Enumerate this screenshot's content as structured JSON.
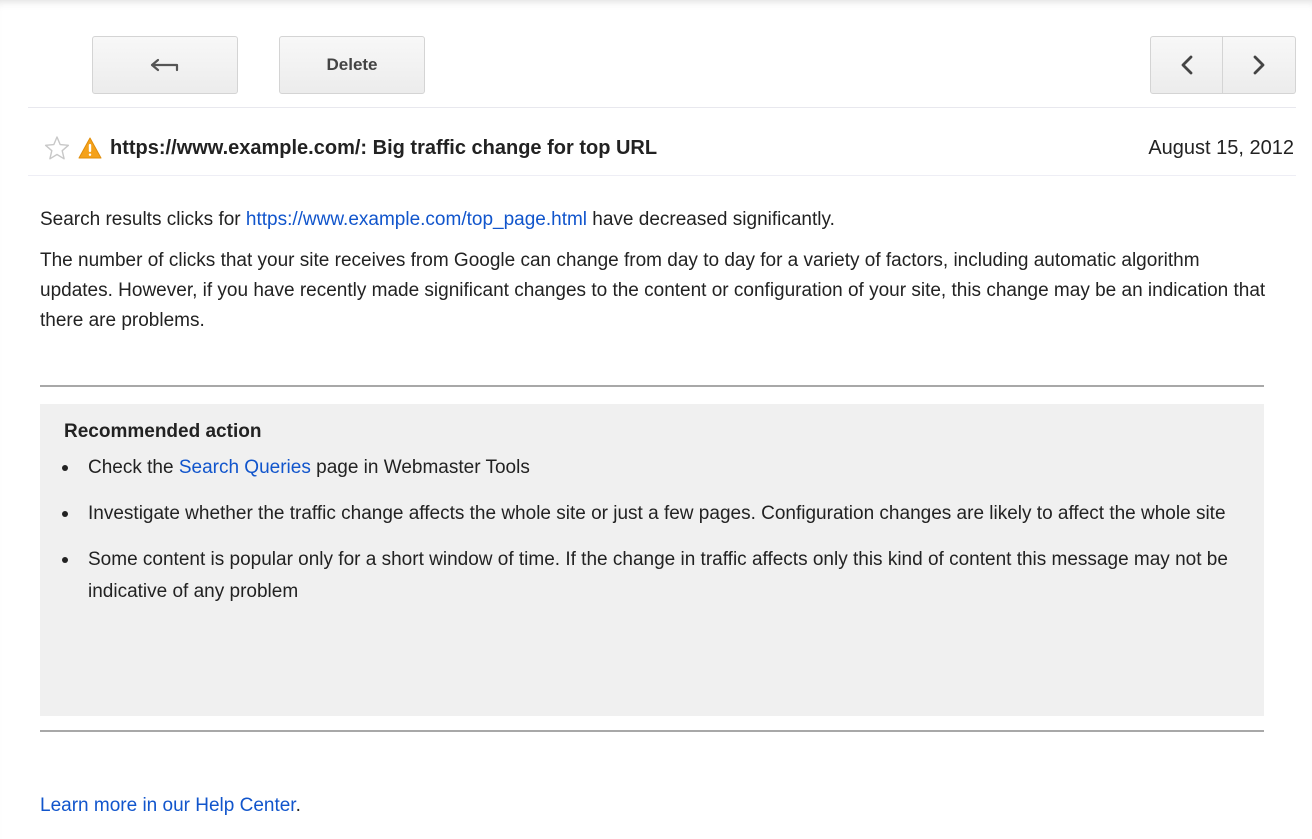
{
  "toolbar": {
    "back_icon": "back-arrow-icon",
    "delete_label": "Delete",
    "prev_icon": "chevron-left-icon",
    "next_icon": "chevron-right-icon"
  },
  "message": {
    "star_icon": "star-outline-icon",
    "warning_icon": "warning-triangle-icon",
    "warning_color": "#f4a11a",
    "subject": "https://www.example.com/: Big traffic change for top URL",
    "date": "August 15, 2012"
  },
  "body": {
    "line1_prefix": "Search results clicks for ",
    "line1_link": "https://www.example.com/top_page.html",
    "line1_suffix": " have decreased significantly.",
    "paragraph2": "The number of clicks that your site receives from Google can change from day to day for a variety of factors, including automatic algorithm updates. However, if you have recently made significant changes to the content or configuration of your site, this change may be an indication that there are problems."
  },
  "recommended": {
    "title": "Recommended action",
    "item1_prefix": "Check the ",
    "item1_link": "Search Queries",
    "item1_suffix": " page in Webmaster Tools",
    "item2": "Investigate whether the traffic change affects the whole site or just a few pages. Configuration changes are likely to affect the whole site",
    "item3": "Some content is popular only for a short window of time. If the change in traffic affects only this kind of content this message may not be indicative of any problem"
  },
  "footer": {
    "link": "Learn more in our Help Center",
    "suffix": "."
  },
  "colors": {
    "link": "#1155cc",
    "panel_bg": "#f0f0f0"
  }
}
